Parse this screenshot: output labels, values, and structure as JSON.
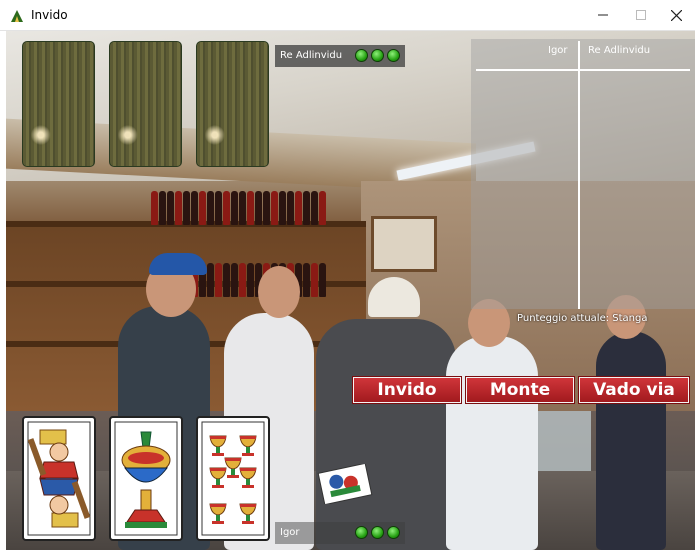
{
  "window": {
    "title": "Invido",
    "minimize_icon": "minimize-icon",
    "maximize_icon": "maximize-icon",
    "close_icon": "close-icon"
  },
  "opponent": {
    "name": "Re Adlinvidu",
    "cards_face_down": 3,
    "points_dots": 3
  },
  "player": {
    "name": "Igor",
    "points_dots": 3,
    "hand": [
      {
        "name": "Re di Bastoni",
        "suit": "bastoni",
        "value": "Re"
      },
      {
        "name": "Asso di Coppe",
        "suit": "coppe",
        "value": "Asso"
      },
      {
        "name": "Sette di Coppe",
        "suit": "coppe",
        "value": "7"
      }
    ]
  },
  "score_table": {
    "col1": "Igor",
    "col2": "Re Adlinvidu"
  },
  "status": {
    "punteggio": "Punteggio attuale: Stanga"
  },
  "buttons": {
    "invido": "Invido",
    "monte": "Monte",
    "vado_via": "Vado via"
  },
  "colors": {
    "button_red": "#b8252a",
    "indicator_green": "#27a214"
  }
}
